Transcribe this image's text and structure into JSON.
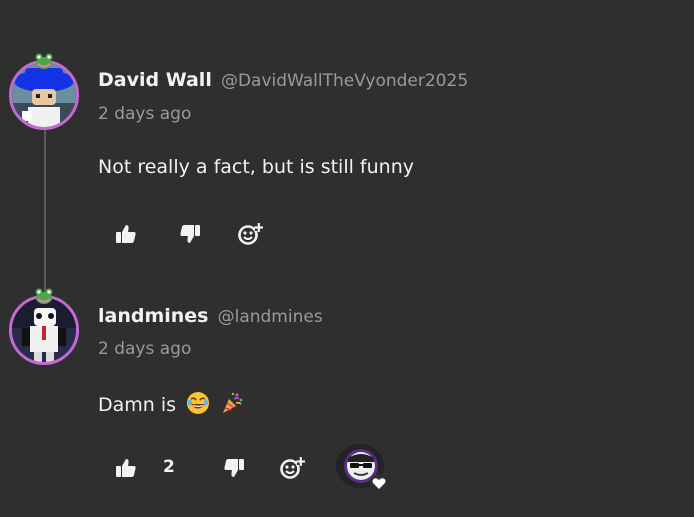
{
  "comments": [
    {
      "display_name": "David Wall",
      "handle": "@DavidWallTheVyonder2025",
      "time": "2 days ago",
      "text": "Not really a fact, but is still funny",
      "avatar_icon": "avatar-blue-hat-icon"
    },
    {
      "display_name": "landmines",
      "handle": "@landmines",
      "time": "2 days ago",
      "text": "Damn is",
      "emojis": [
        "laughing-emoji",
        "party-popper-emoji"
      ],
      "like_count": "2",
      "avatar_icon": "avatar-panda-suit-icon",
      "creator_heart": true
    }
  ],
  "colors": {
    "background": "#2f2f2f",
    "text": "#f2f2f2",
    "muted": "#9a9a9a",
    "avatar_ring": "#c36ad4"
  }
}
